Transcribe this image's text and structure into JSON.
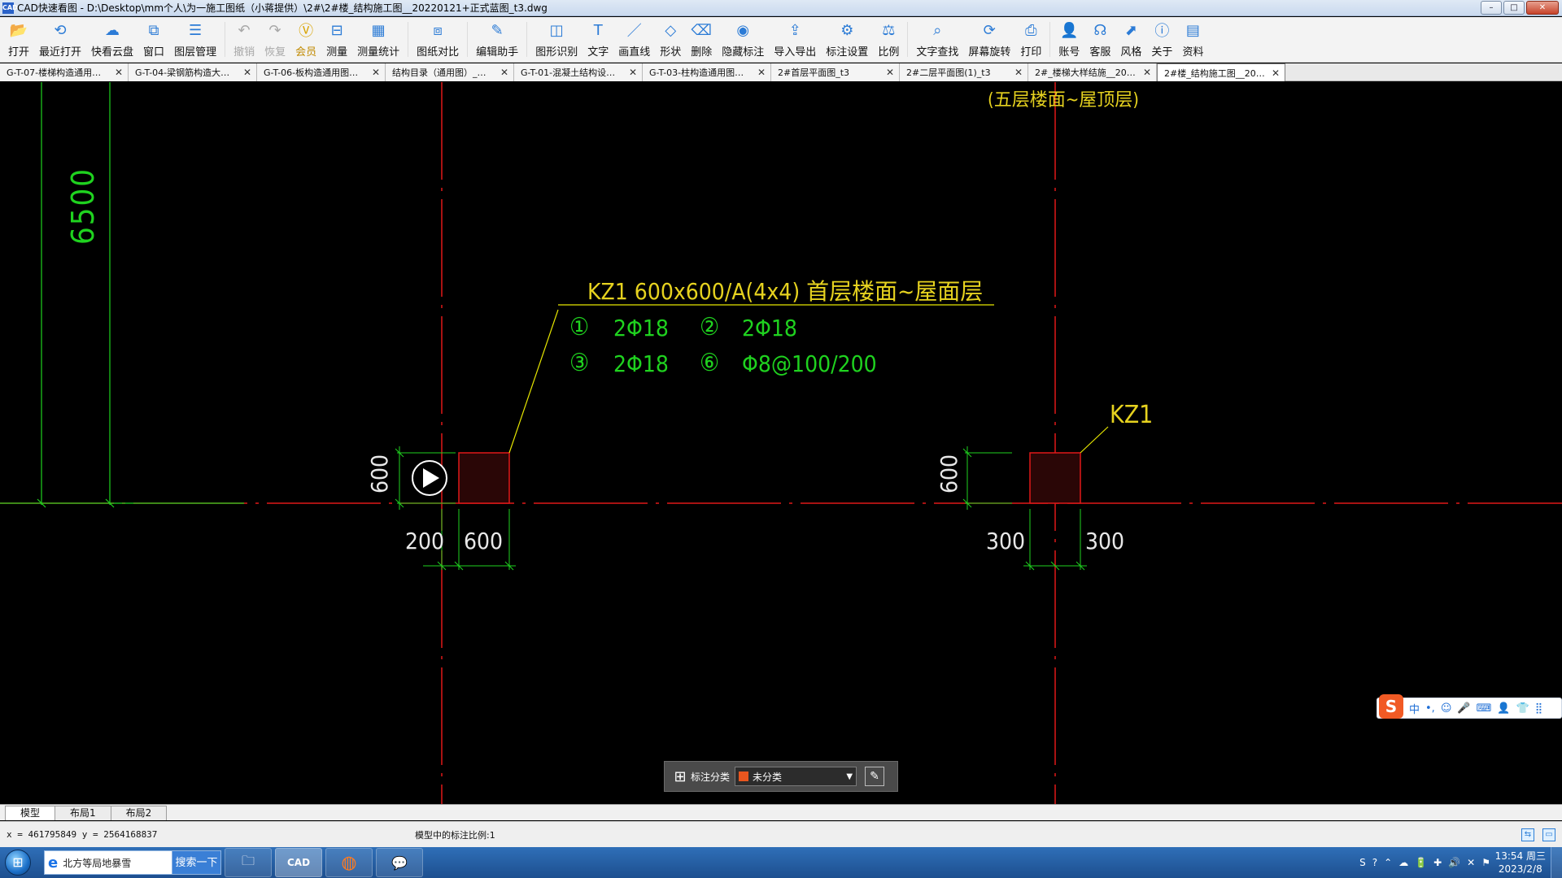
{
  "window": {
    "app_icon": "CAD",
    "title": "CAD快速看图 - D:\\Desktop\\mm个人\\为一施工图纸（小蒋提供）\\2#\\2#楼_结构施工图__20220121+正式蓝图_t3.dwg",
    "minimize": "–",
    "maximize": "□",
    "close": "✕"
  },
  "toolbar": [
    {
      "name": "open",
      "label": "打开",
      "icon": "📂",
      "enabled": true
    },
    {
      "name": "recent-open",
      "label": "最近打开",
      "icon": "⟲",
      "enabled": true
    },
    {
      "name": "cloud-disk",
      "label": "快看云盘",
      "icon": "☁",
      "enabled": true
    },
    {
      "name": "window",
      "label": "窗口",
      "icon": "⧉",
      "enabled": true
    },
    {
      "name": "layer-manage",
      "label": "图层管理",
      "icon": "☰",
      "enabled": true
    },
    {
      "name": "undo",
      "label": "撤销",
      "icon": "↶",
      "enabled": false
    },
    {
      "name": "redo",
      "label": "恢复",
      "icon": "↷",
      "enabled": false
    },
    {
      "name": "vip",
      "label": "会员",
      "icon": "Ⓥ",
      "enabled": true,
      "vip": true
    },
    {
      "name": "measure",
      "label": "测量",
      "icon": "⊟",
      "enabled": true
    },
    {
      "name": "measure-stats",
      "label": "测量统计",
      "icon": "▦",
      "enabled": true
    },
    {
      "name": "compare",
      "label": "图纸对比",
      "icon": "⧈",
      "enabled": true
    },
    {
      "name": "edit-assistant",
      "label": "编辑助手",
      "icon": "✎",
      "enabled": true
    },
    {
      "name": "shape-recognize",
      "label": "图形识别",
      "icon": "◫",
      "enabled": true
    },
    {
      "name": "text",
      "label": "文字",
      "icon": "T",
      "enabled": true
    },
    {
      "name": "draw-line",
      "label": "画直线",
      "icon": "／",
      "enabled": true
    },
    {
      "name": "shape",
      "label": "形状",
      "icon": "◇",
      "enabled": true
    },
    {
      "name": "delete",
      "label": "删除",
      "icon": "⌫",
      "enabled": true
    },
    {
      "name": "hide-annotation",
      "label": "隐藏标注",
      "icon": "◉",
      "enabled": true
    },
    {
      "name": "import-export",
      "label": "导入导出",
      "icon": "⇪",
      "enabled": true
    },
    {
      "name": "annotation-settings",
      "label": "标注设置",
      "icon": "⚙",
      "enabled": true
    },
    {
      "name": "scale",
      "label": "比例",
      "icon": "⚖",
      "enabled": true
    },
    {
      "name": "text-search",
      "label": "文字查找",
      "icon": "⌕",
      "enabled": true
    },
    {
      "name": "screen-rotate",
      "label": "屏幕旋转",
      "icon": "⟳",
      "enabled": true
    },
    {
      "name": "print",
      "label": "打印",
      "icon": "⎙",
      "enabled": true
    },
    {
      "name": "account",
      "label": "账号",
      "icon": "👤",
      "enabled": true
    },
    {
      "name": "customer-service",
      "label": "客服",
      "icon": "☊",
      "enabled": true
    },
    {
      "name": "style",
      "label": "风格",
      "icon": "⬈",
      "enabled": true
    },
    {
      "name": "about",
      "label": "关于",
      "icon": "ⓘ",
      "enabled": true
    },
    {
      "name": "materials",
      "label": "资料",
      "icon": "▤",
      "enabled": true
    }
  ],
  "tabs": [
    {
      "label": "G-T-07-楼梯构造通用…",
      "active": false
    },
    {
      "label": "G-T-04-梁钢筋构造大…",
      "active": false
    },
    {
      "label": "G-T-06-板构造通用图…",
      "active": false
    },
    {
      "label": "结构目录（通用图）_…",
      "active": false
    },
    {
      "label": "G-T-01-混凝土结构设…",
      "active": false
    },
    {
      "label": "G-T-03-柱构造通用图…",
      "active": false
    },
    {
      "label": "2#首层平面图_t3",
      "active": false
    },
    {
      "label": "2#二层平面图(1)_t3",
      "active": false
    },
    {
      "label": "2#_楼梯大样结施__20…",
      "active": false
    },
    {
      "label": "2#楼_结构施工图__20…",
      "active": true
    }
  ],
  "drawing": {
    "top_note": "(五层楼面~屋顶层)",
    "dim_6500": "6500",
    "column_label": "KZ1 600x600/A(4x4) 首层楼面~屋面层",
    "rebar": [
      {
        "num": "①",
        "spec": "2Φ18"
      },
      {
        "num": "②",
        "spec": "2Φ18"
      },
      {
        "num": "③",
        "spec": "2Φ18"
      },
      {
        "num": "⑥",
        "spec": "Φ8@100/200"
      }
    ],
    "kz1_right": "KZ1",
    "dim_left_height": "600",
    "dim_left_offset": "200",
    "dim_left_width": "600",
    "dim_right_height": "600",
    "dim_right_left": "300",
    "dim_right_right": "300"
  },
  "annotation_bar": {
    "grid_icon": "⊞",
    "label": "标注分类",
    "selected": "未分类",
    "swatch_color": "#e8561f",
    "dropdown_icon": "▼",
    "edit_icon": "✎"
  },
  "ime": {
    "logo": "S",
    "items": [
      "中",
      "•,",
      "☺",
      "🎤",
      "⌨",
      "👤",
      "👕",
      "⣿"
    ]
  },
  "layout_tabs": [
    {
      "label": "模型",
      "active": true
    },
    {
      "label": "布局1",
      "active": false
    },
    {
      "label": "布局2",
      "active": false
    }
  ],
  "status": {
    "coords": "x = 461795849  y = 2564168837",
    "scale_text": "模型中的标注比例:1",
    "icons": [
      "⇆",
      "▭"
    ]
  },
  "taskbar": {
    "start_icon": "⊞",
    "search_text": "北方等局地暴雪",
    "search_icon": "e",
    "search_button": "搜索一下",
    "apps": [
      {
        "name": "file-explorer",
        "icon": "🗀",
        "active": false
      },
      {
        "name": "cad-viewer",
        "icon": "CAD",
        "active": true
      },
      {
        "name": "firefox",
        "icon": "◍",
        "active": false
      },
      {
        "name": "wechat",
        "icon": "💬",
        "active": false
      }
    ],
    "tray": [
      "S",
      "?",
      "⌃",
      "☁",
      "🔋",
      "✚",
      "🔊",
      "✕",
      "⚑"
    ],
    "time": "13:54 周三",
    "date": "2023/2/8"
  }
}
